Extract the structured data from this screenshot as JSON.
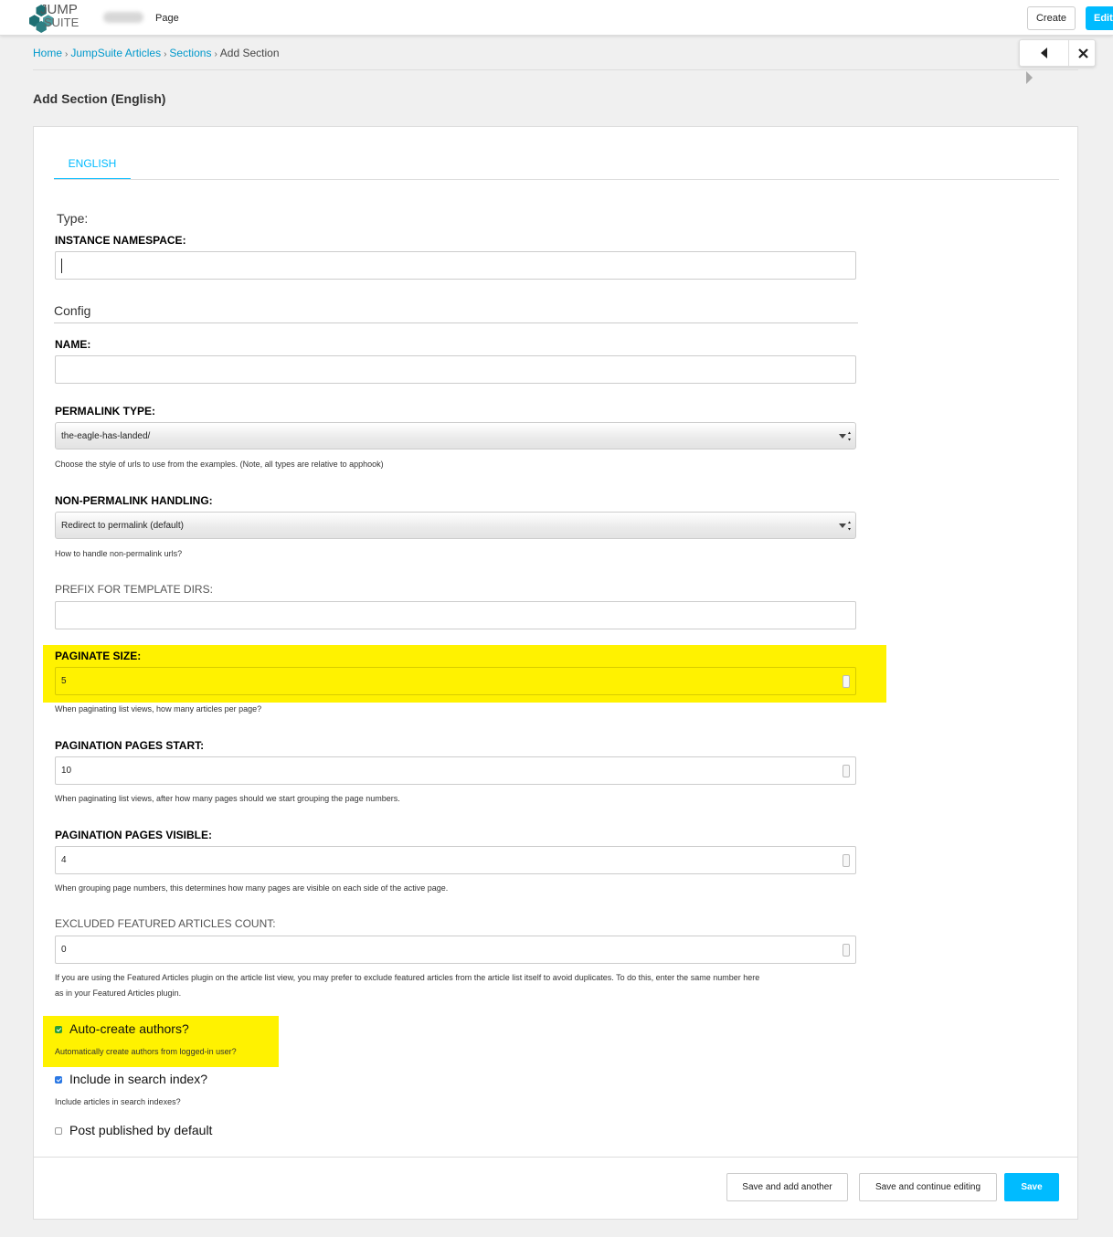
{
  "toolbar": {
    "logo_line1": "JUMP",
    "logo_line2": "SUITE",
    "page_label": "Page",
    "create_label": "Create",
    "edit_label": "Edit"
  },
  "breadcrumb": {
    "items": [
      "Home",
      "JumpSuite Articles",
      "Sections"
    ],
    "current": "Add Section",
    "separator": "›"
  },
  "page_title": "Add Section (English)",
  "tabs": [
    {
      "label": "ENGLISH",
      "active": true
    }
  ],
  "form": {
    "type_heading": "Type:",
    "instance_namespace": {
      "label": "INSTANCE NAMESPACE:",
      "value": ""
    },
    "config_heading": "Config",
    "name": {
      "label": "NAME:",
      "value": ""
    },
    "permalink_type": {
      "label": "PERMALINK TYPE:",
      "value": "the-eagle-has-landed/",
      "help": "Choose the style of urls to use from the examples. (Note, all types are relative to apphook)"
    },
    "non_permalink": {
      "label": "NON-PERMALINK HANDLING:",
      "value": "Redirect to permalink (default)",
      "help": "How to handle non-permalink urls?"
    },
    "prefix": {
      "label": "PREFIX FOR TEMPLATE DIRS:",
      "value": ""
    },
    "paginate_size": {
      "label": "PAGINATE SIZE:",
      "value": "5",
      "help": "When paginating list views, how many articles per page?"
    },
    "pagination_start": {
      "label": "PAGINATION PAGES START:",
      "value": "10",
      "help": "When paginating list views, after how many pages should we start grouping the page numbers."
    },
    "pagination_visible": {
      "label": "PAGINATION PAGES VISIBLE:",
      "value": "4",
      "help": "When grouping page numbers, this determines how many pages are visible on each side of the active page."
    },
    "excluded_featured": {
      "label": "EXCLUDED FEATURED ARTICLES COUNT:",
      "value": "0",
      "help_line1": "If you are using the Featured Articles plugin on the article list view, you may prefer to exclude featured articles from the article list itself to avoid duplicates. To do this, enter the same number here",
      "help_line2": "as in your Featured Articles plugin."
    },
    "auto_create_authors": {
      "label": "Auto-create authors?",
      "checked": true,
      "help": "Automatically create authors from logged-in user?"
    },
    "search_index": {
      "label": "Include in search index?",
      "checked": true,
      "help": "Include articles in search indexes?"
    },
    "post_published": {
      "label": "Post published by default",
      "checked": false
    }
  },
  "footer": {
    "save_add_another": "Save and add another",
    "save_continue": "Save and continue editing",
    "save": "Save"
  },
  "colors": {
    "accent": "#00bbff",
    "highlight": "#fff200",
    "logo": "#1e6f73"
  }
}
